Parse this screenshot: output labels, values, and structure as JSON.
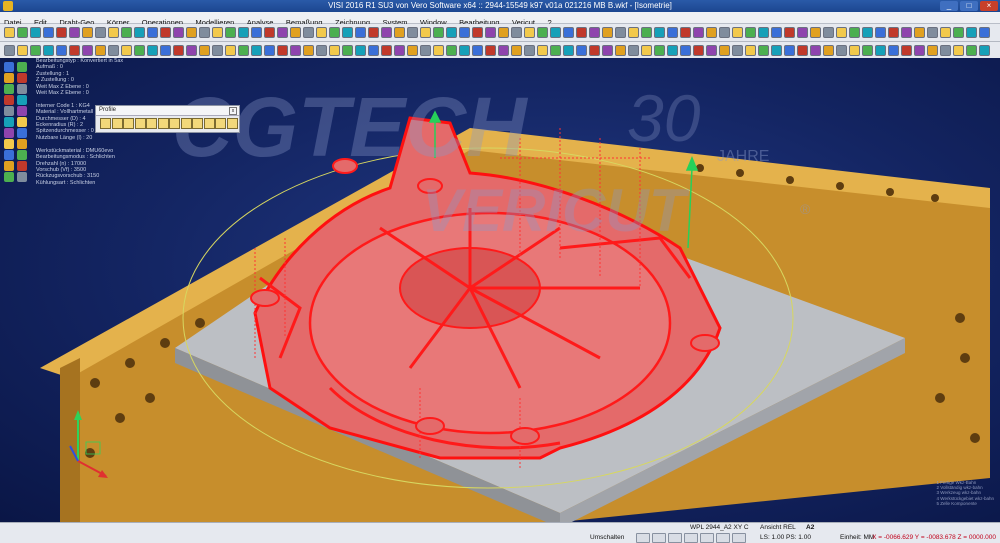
{
  "window": {
    "title": "VISI 2016 R1 SU3 von Vero Software x64 :: 2944-15549 k97 v01a 021216 MB B.wkf - [Isometrie]",
    "controls": [
      "_",
      "□",
      "×"
    ]
  },
  "menu": [
    "Datei",
    "Edit",
    "Draht-Geo",
    "Körper",
    "Operationen",
    "Modellieren",
    "Analyse",
    "Bemaßung",
    "Zeichnung",
    "System",
    "Window",
    "Bearbeitung",
    "Vericut",
    "?"
  ],
  "info_panel": {
    "lines": [
      "Bearbeitungstyp : Konvertiert in 5ax",
      "Aufmaß : 0",
      "Zustellung : 1",
      "Z Zustellung : 0",
      "Weit Max Z Ebene : 0",
      "Weit Max Z Ebene : 0",
      "",
      "Interner Code 1 : KG4",
      "Material : Vollhartmetall",
      "Durchmesser (D) : 4",
      "Eckenradius (R) : 2",
      "Spitzendurchmesser : 0",
      "Nutzbare Länge (l) : 20",
      "",
      "Werkstückmaterial : DMU60evo",
      "Bearbeitungsmodus : Schlichten",
      "Drehzahl (n) : 17000",
      "Vorschub (Vf) : 3500",
      "Rückzugsvorschub : 3150",
      "Kühlungsart : Schlichten"
    ]
  },
  "profile_toolbar": {
    "title": "Profile",
    "close": "x",
    "icons": [
      "profile-icon-1",
      "profile-icon-2",
      "profile-icon-3",
      "profile-icon-4",
      "profile-icon-5",
      "profile-icon-6",
      "profile-icon-7",
      "profile-icon-8",
      "profile-icon-9",
      "profile-icon-10",
      "profile-icon-11",
      "profile-icon-12"
    ]
  },
  "watermark": {
    "brand": "CGTECH",
    "sub": "VERICUT",
    "anniversary": "30",
    "anniversary_label": "JAHRE",
    "registered": "®"
  },
  "layers_legend": [
    "1  Fertige Wkz-Bahn",
    "2  Vollständig wkz-bahn",
    "3  Werkzeug wkz-bahn",
    "4  Werkstückgebiet wkz-bahn",
    "5  Zelle Komponente"
  ],
  "statusbar": {
    "wpl": "WPL 2944_A2 XY C",
    "view": "Ansicht REL",
    "layer": "A2",
    "button": "Umschalten",
    "ls": "LS: 1.00 PS: 1.00",
    "unit": "Einheit: MM",
    "coords": "X = -0066.629 Y = -0083.678 Z = 0000.000"
  },
  "colors": {
    "toolpath": "#ff1a1a",
    "part": "#e85a5a",
    "fixture": "#d8a33a",
    "plate": "#b9bcc0",
    "background": "#13256a"
  }
}
